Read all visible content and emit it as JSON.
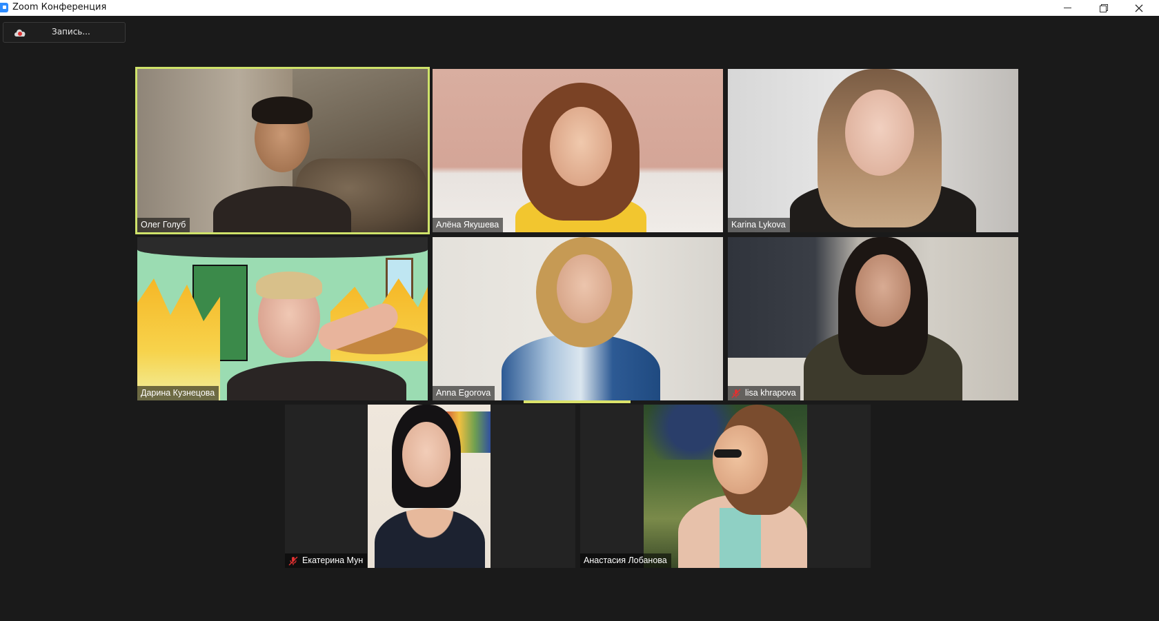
{
  "window": {
    "title": "Zoom Конференция",
    "controls": {
      "minimize": "minimize",
      "maximize": "restore",
      "close": "close"
    }
  },
  "toolbar": {
    "record_label": "Запись..."
  },
  "colors": {
    "background": "#1a1a1a",
    "active_speaker_border": "#cfe36a",
    "muted_icon": "#e03131"
  },
  "participants": [
    {
      "name": "Олег Голуб",
      "muted": false,
      "active": true
    },
    {
      "name": "Алёна Якушева",
      "muted": false,
      "active": false
    },
    {
      "name": "Karina Lykova",
      "muted": false,
      "active": false
    },
    {
      "name": "Дарина Кузнецова",
      "muted": false,
      "active": false
    },
    {
      "name": "Anna Egorova",
      "muted": false,
      "active": false,
      "speaking": true
    },
    {
      "name": "lisa khrapova",
      "muted": true,
      "active": false
    },
    {
      "name": "Екатерина Мун",
      "muted": true,
      "active": false
    },
    {
      "name": "Анастасия Лобанова",
      "muted": false,
      "active": false
    }
  ]
}
